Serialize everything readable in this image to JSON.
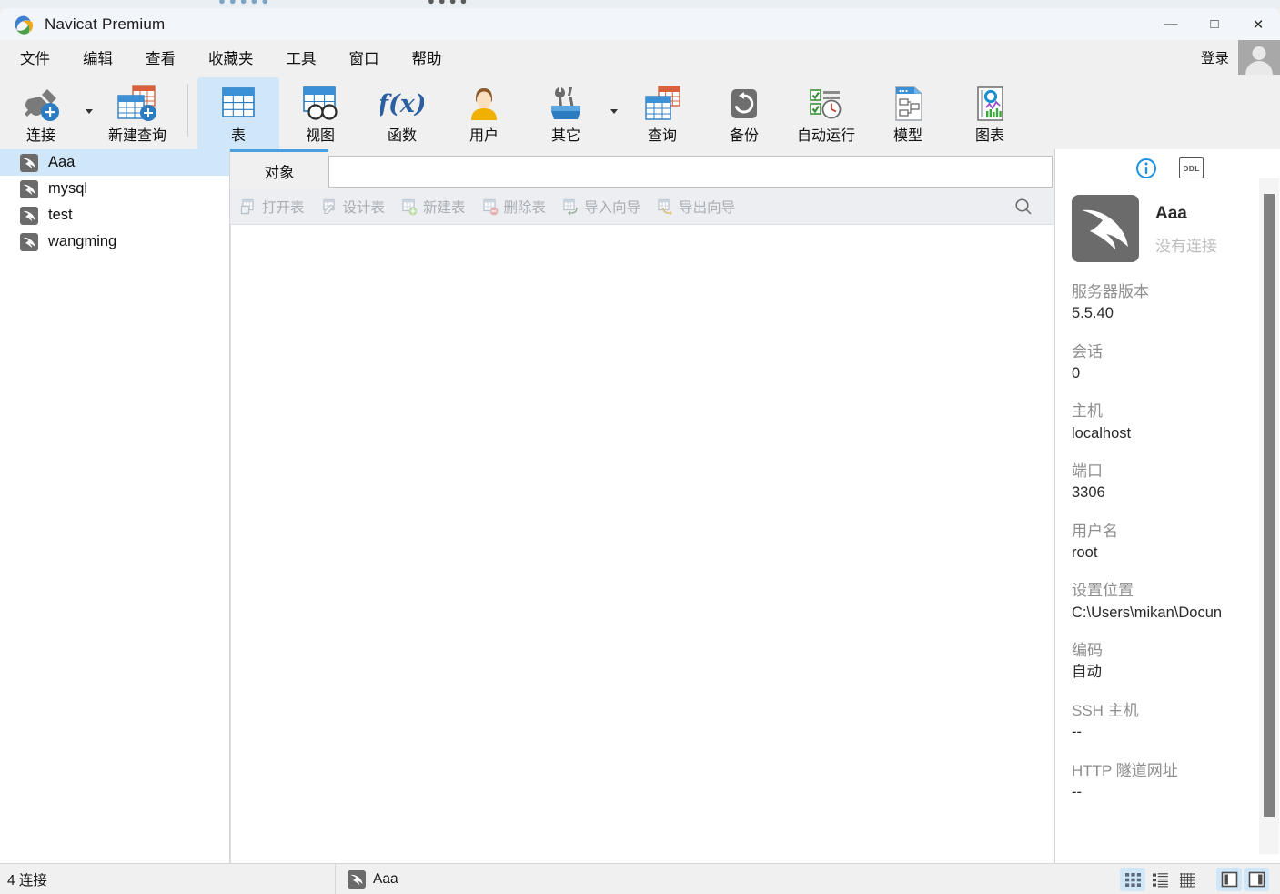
{
  "window": {
    "title": "Navicat Premium",
    "logo_icon": "navicat-logo-icon",
    "minimize_icon": "minimize-icon",
    "maximize_icon": "maximize-icon",
    "close_icon": "close-icon",
    "minimize_label": "—",
    "maximize_label": "□",
    "close_label": "✕"
  },
  "menubar": {
    "items": [
      {
        "label": "文件"
      },
      {
        "label": "编辑"
      },
      {
        "label": "查看"
      },
      {
        "label": "收藏夹"
      },
      {
        "label": "工具"
      },
      {
        "label": "窗口"
      },
      {
        "label": "帮助"
      }
    ],
    "login_label": "登录",
    "avatar_icon": "user-avatar-icon"
  },
  "toolbar": {
    "items": [
      {
        "label": "连接",
        "icon": "connection-plug-plus-icon",
        "active": false,
        "caret": true
      },
      {
        "label": "新建查询",
        "icon": "new-query-plus-icon",
        "active": false,
        "caret": false
      },
      {
        "label": "表",
        "icon": "table-icon",
        "active": true,
        "caret": false
      },
      {
        "label": "视图",
        "icon": "view-glasses-icon",
        "active": false,
        "caret": false
      },
      {
        "label": "函数",
        "icon": "function-fx-icon",
        "active": false,
        "caret": false
      },
      {
        "label": "用户",
        "icon": "user-icon",
        "active": false,
        "caret": false
      },
      {
        "label": "其它",
        "icon": "other-tools-icon",
        "active": false,
        "caret": true
      },
      {
        "label": "查询",
        "icon": "query-table-icon",
        "active": false,
        "caret": false
      },
      {
        "label": "备份",
        "icon": "backup-restore-icon",
        "active": false,
        "caret": false
      },
      {
        "label": "自动运行",
        "icon": "automation-clock-icon",
        "active": false,
        "caret": false
      },
      {
        "label": "模型",
        "icon": "model-diagram-icon",
        "active": false,
        "caret": false
      },
      {
        "label": "图表",
        "icon": "chart-report-icon",
        "active": false,
        "caret": false
      }
    ]
  },
  "sidebar": {
    "connections": [
      {
        "name": "Aaa",
        "icon": "mysql-dolphin-icon",
        "selected": true
      },
      {
        "name": "mysql",
        "icon": "mysql-dolphin-icon",
        "selected": false
      },
      {
        "name": "test",
        "icon": "mysql-dolphin-icon",
        "selected": false
      },
      {
        "name": "wangming",
        "icon": "mysql-dolphin-icon",
        "selected": false
      }
    ]
  },
  "center": {
    "tab_label": "对象",
    "filter_value": "",
    "filter_placeholder": "",
    "object_toolbar": [
      {
        "label": "打开表",
        "icon": "open-table-icon",
        "disabled": true
      },
      {
        "label": "设计表",
        "icon": "design-table-icon",
        "disabled": true
      },
      {
        "label": "新建表",
        "icon": "new-table-icon",
        "disabled": true
      },
      {
        "label": "删除表",
        "icon": "delete-table-icon",
        "disabled": true
      },
      {
        "label": "导入向导",
        "icon": "import-wizard-icon",
        "disabled": true
      },
      {
        "label": "导出向导",
        "icon": "export-wizard-icon",
        "disabled": true
      }
    ],
    "search_icon": "search-icon"
  },
  "info_panel": {
    "tabs": [
      {
        "name": "info-tab",
        "icon": "info-circle-icon",
        "active": true
      },
      {
        "name": "ddl-tab",
        "icon": "ddl-icon",
        "label": "DDL",
        "active": false
      }
    ],
    "avatar_icon": "mysql-dolphin-icon",
    "connection_name": "Aaa",
    "connection_status": "没有连接",
    "fields": [
      {
        "key": "服务器版本",
        "value": "5.5.40"
      },
      {
        "key": "会话",
        "value": "0"
      },
      {
        "key": "主机",
        "value": "localhost"
      },
      {
        "key": "端口",
        "value": "3306"
      },
      {
        "key": "用户名",
        "value": "root"
      },
      {
        "key": "设置位置",
        "value": "C:\\Users\\mikan\\Docun"
      },
      {
        "key": "编码",
        "value": "自动"
      },
      {
        "key": "SSH 主机",
        "value": "--"
      },
      {
        "key": "HTTP 隧道网址",
        "value": "--"
      }
    ]
  },
  "statusbar": {
    "connection_count_label": "4 连接",
    "current_connection": "Aaa",
    "current_connection_icon": "mysql-dolphin-icon",
    "view_buttons": [
      {
        "name": "grid-view-button",
        "icon": "grid-view-icon",
        "active": true
      },
      {
        "name": "list-view-button",
        "icon": "list-view-icon",
        "active": false
      },
      {
        "name": "detail-view-button",
        "icon": "detail-grid-icon",
        "active": false
      }
    ],
    "panel_buttons": [
      {
        "name": "toggle-left-panel-button",
        "icon": "left-panel-icon",
        "active": true
      },
      {
        "name": "toggle-right-panel-button",
        "icon": "right-panel-icon",
        "active": true
      }
    ]
  },
  "colors": {
    "accent": "#4a9fe0",
    "selection": "#cfe7f8",
    "chrome": "#f0f0f0",
    "titlebar": "#f2f5f9"
  }
}
